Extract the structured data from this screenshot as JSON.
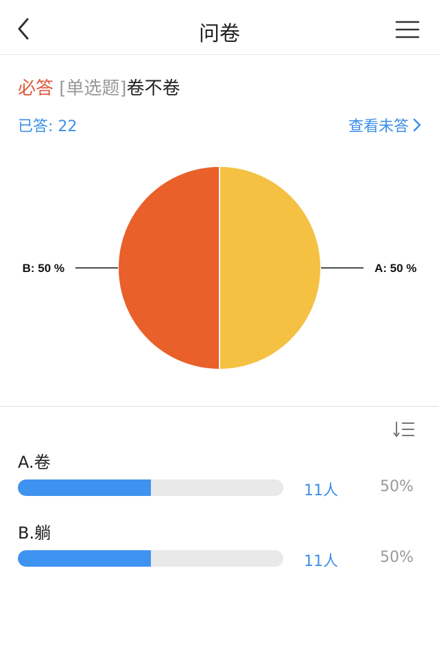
{
  "header": {
    "title": "问卷",
    "back_icon": "chevron-left-icon",
    "menu_icon": "hamburger-menu-icon"
  },
  "question": {
    "required_label": "必答",
    "type_label": "[单选题]",
    "title": "卷不卷"
  },
  "stats": {
    "answered_label": "已答: 22",
    "view_unanswered_label": "查看未答"
  },
  "chart_data": {
    "type": "pie",
    "slices": [
      {
        "label": "A: 50 %",
        "category": "A",
        "value": 50,
        "color": "#f4c143"
      },
      {
        "label": "B: 50 %",
        "category": "B",
        "value": 50,
        "color": "#e9602a"
      }
    ]
  },
  "options": [
    {
      "label": "A.卷",
      "count": "11人",
      "percent": "50%",
      "fraction": 0.5
    },
    {
      "label": "B.躺",
      "count": "11人",
      "percent": "50%",
      "fraction": 0.5
    }
  ],
  "colors": {
    "accent": "#3b8fe8",
    "required": "#e05a3c",
    "bar_fill": "#3f93f0"
  },
  "sort_icon": "sort-list-icon"
}
